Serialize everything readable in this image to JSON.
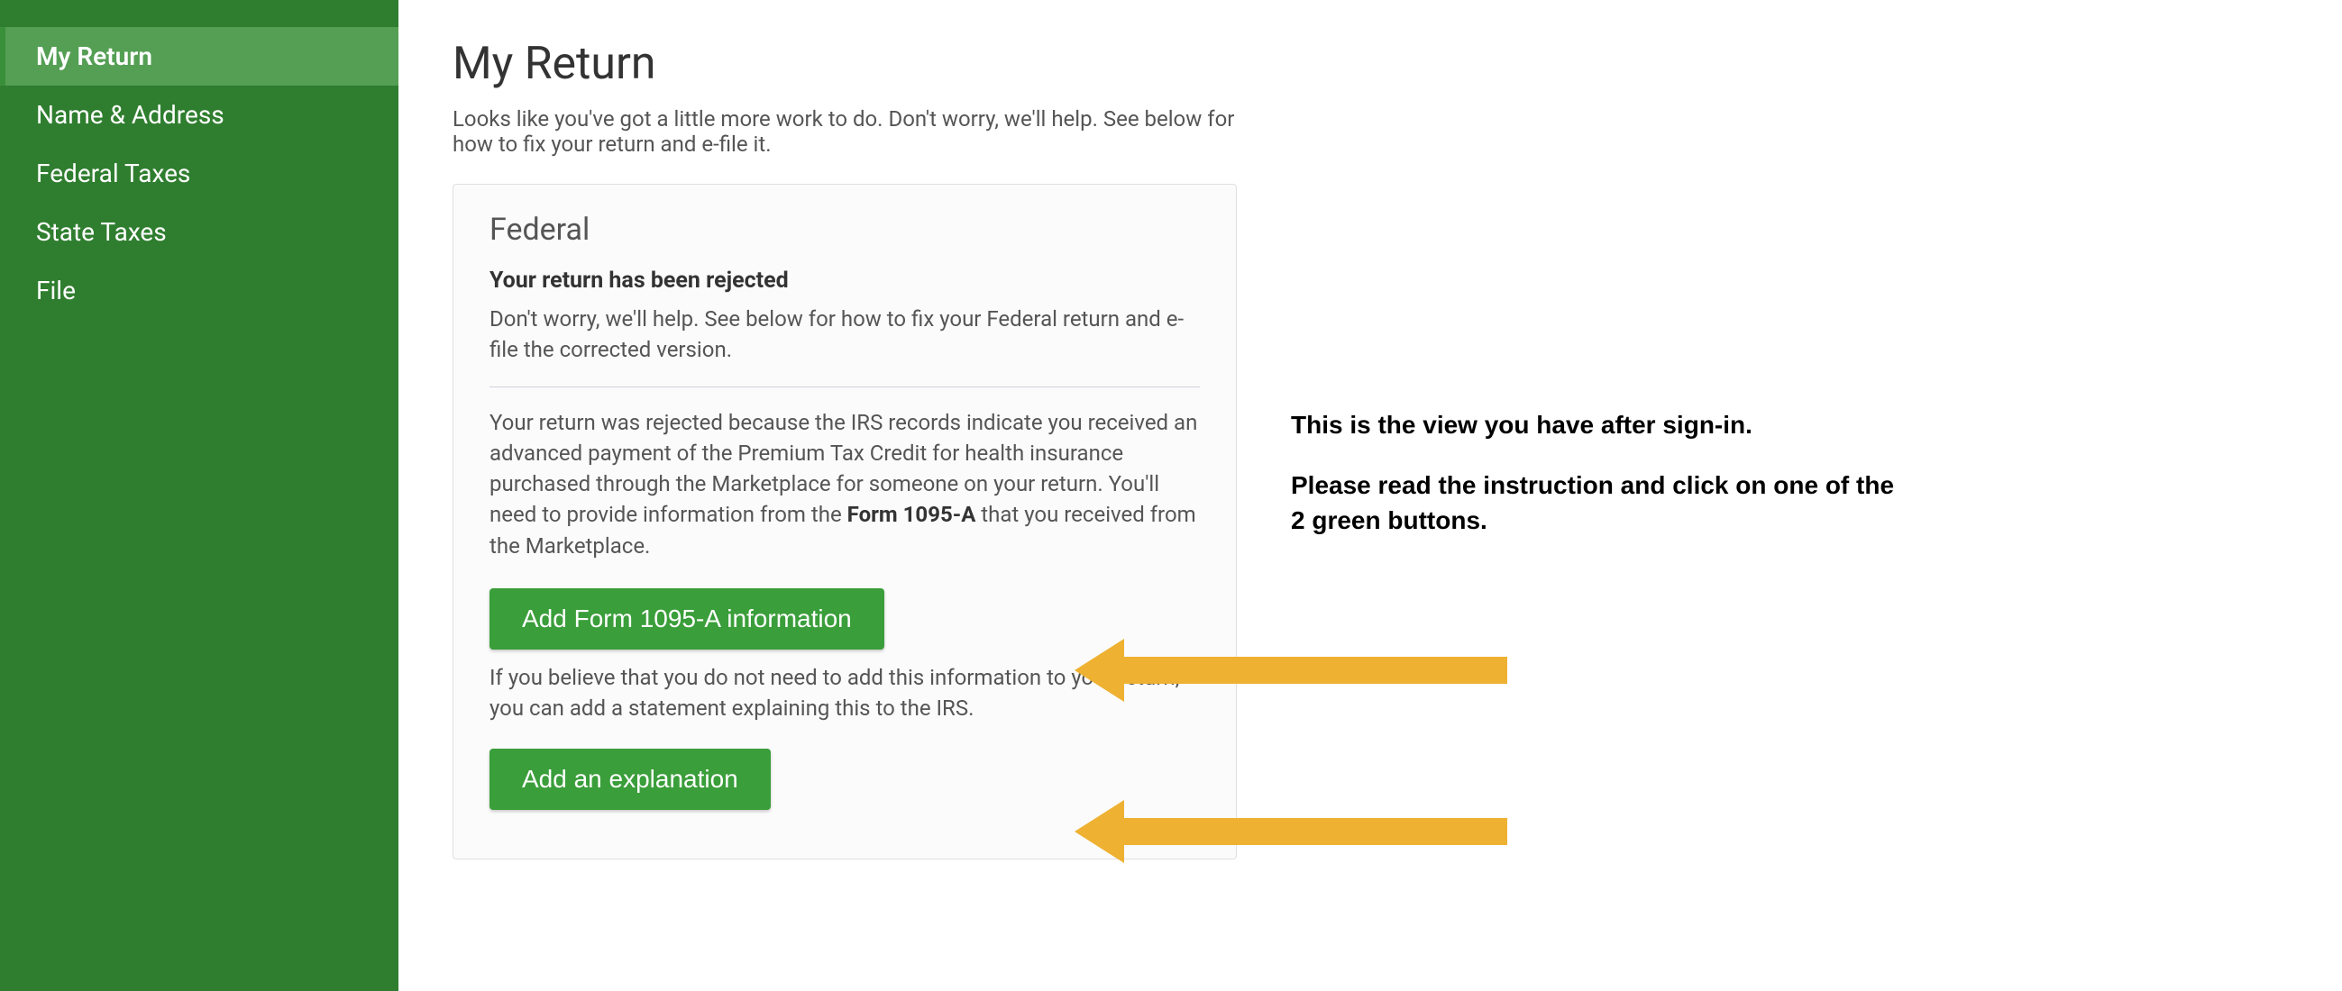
{
  "sidebar": {
    "items": [
      {
        "label": "My Return",
        "active": true
      },
      {
        "label": "Name & Address",
        "active": false
      },
      {
        "label": "Federal Taxes",
        "active": false
      },
      {
        "label": "State Taxes",
        "active": false
      },
      {
        "label": "File",
        "active": false
      }
    ]
  },
  "page": {
    "title": "My Return",
    "subtitle": "Looks like you've got a little more work to do. Don't worry, we'll help. See below for how to fix your return and e-file it."
  },
  "card": {
    "title": "Federal",
    "rejection_heading": "Your return has been rejected",
    "rejection_text": "Don't worry, we'll help. See below for how to fix your Federal return and e-file the corrected version.",
    "explanation_pre": "Your return was rejected because the IRS records indicate you received an advanced payment of the Premium Tax Credit for health insurance purchased through the Marketplace for someone on your return. You'll need to provide information from the ",
    "explanation_bold": "Form 1095-A",
    "explanation_post": " that you received from the Marketplace.",
    "button_1_label": "Add Form 1095-A information",
    "alt_text": "If you believe that you do not need to add this information to your return, you can add a statement explaining this to the IRS.",
    "button_2_label": "Add an explanation"
  },
  "annotations": {
    "line1": "This is the view you have after sign-in.",
    "line2": "Please read the instruction and click on one of the 2 green buttons."
  },
  "colors": {
    "sidebar_bg": "#2f7e2f",
    "sidebar_active_bg": "#549f54",
    "button_green": "#3a9e3a",
    "arrow_color": "#eeb132"
  }
}
